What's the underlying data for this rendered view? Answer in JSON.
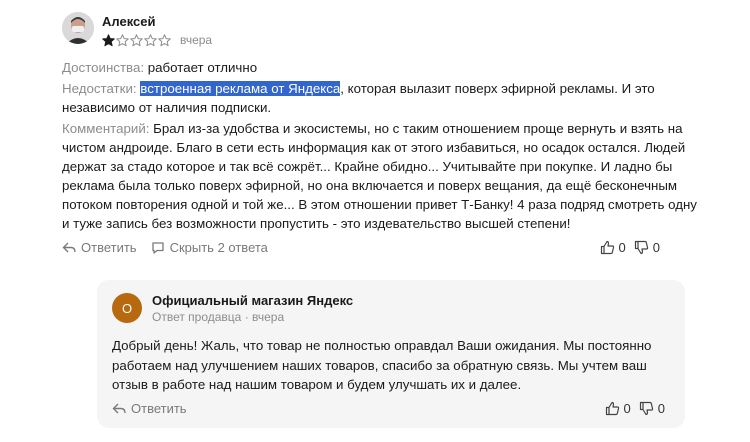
{
  "review": {
    "author": "Алексей",
    "rating": 1,
    "rating_max": 5,
    "date": "вчера",
    "pros_label": "Достоинства:",
    "pros_text": " работает отлично",
    "cons_label": "Недостатки:",
    "cons_highlight": "встроенная реклама от Яндекса",
    "cons_text": ", которая вылазит поверх эфирной рекламы. И это независимо от наличия подписки.",
    "comment_label": "Комментарий:",
    "comment_text": " Брал из-за удобства и экосистемы, но с таким отношением проще вернуть и взять на чистом андроиде. Благо в сети есть информация как от этого избавиться, но осадок остался. Людей держат за стадо которое и так всё сожрёт... Крайне обидно... Учитывайте при покупке. И ладно бы реклама была только поверх эфирной, но она включается и поверх вещания, да ещё бесконечным потоком повторения одной и той же... В этом отношении привет Т-Банку! 4 раза подряд смотреть одну и туже запись без возможности пропустить - это издевательство высшей степени!",
    "reply_label": "Ответить",
    "hide_replies_label": "Скрыть 2 ответа",
    "likes": "0",
    "dislikes": "0"
  },
  "seller_reply": {
    "avatar_letter": "О",
    "author": "Официальный магазин Яндекс",
    "meta": "Ответ продавца · вчера",
    "text": "Добрый день! Жаль, что товар не полностью оправдал Ваши ожидания. Мы постоянно работаем над улучшением наших товаров, спасибо за обратную связь.  Мы учтем ваш отзыв в работе над нашим товаром и будем улучшать их и далее.",
    "reply_label": "Ответить",
    "likes": "0",
    "dislikes": "0"
  },
  "colors": {
    "highlight": "#3366cc",
    "star_filled": "#1a1a1a",
    "seller_avatar": "#b8680f",
    "reply_bg": "#f5f5f5"
  }
}
